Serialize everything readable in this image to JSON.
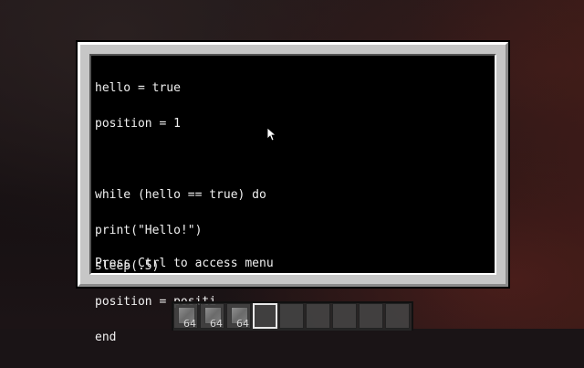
{
  "terminal": {
    "code_lines": [
      "hello = true",
      "position = 1",
      "",
      "while (hello == true) do",
      "print(\"Hello!\")",
      "sleep(.5)",
      "position = positi",
      "end"
    ],
    "status": "Press Ctrl to access menu"
  },
  "hotbar": {
    "slots": [
      {
        "item": "stone-block-icon",
        "count": "64"
      },
      {
        "item": "stone-block-icon",
        "count": "64"
      },
      {
        "item": "stone-block-icon",
        "count": "64"
      },
      {
        "item": "",
        "count": ""
      },
      {
        "item": "",
        "count": ""
      },
      {
        "item": "",
        "count": ""
      },
      {
        "item": "",
        "count": ""
      },
      {
        "item": "",
        "count": ""
      },
      {
        "item": "",
        "count": ""
      }
    ],
    "selected_index": 3
  },
  "colors": {
    "screen_background": "#000000",
    "text": "#f0f0f0",
    "frame": "#c6c6c6"
  }
}
